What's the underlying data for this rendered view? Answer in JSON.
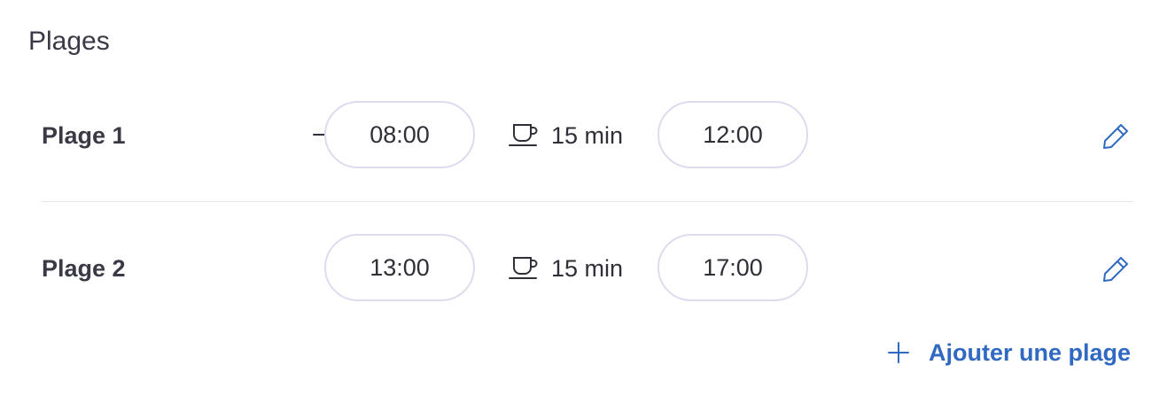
{
  "section": {
    "title": "Plages"
  },
  "ranges": [
    {
      "label": "Plage 1",
      "start": "08:00",
      "break": "15 min",
      "end": "12:00"
    },
    {
      "label": "Plage 2",
      "start": "13:00",
      "break": "15 min",
      "end": "17:00"
    }
  ],
  "actions": {
    "add_range": "Ajouter une plage"
  },
  "icons": {
    "arrow": "arrow-right-icon",
    "break": "coffee-cup-icon",
    "edit": "pencil-icon",
    "add": "plus-icon"
  },
  "colors": {
    "accent": "#2f69c2",
    "pill_border": "#dcdcef",
    "text": "#33333d"
  }
}
